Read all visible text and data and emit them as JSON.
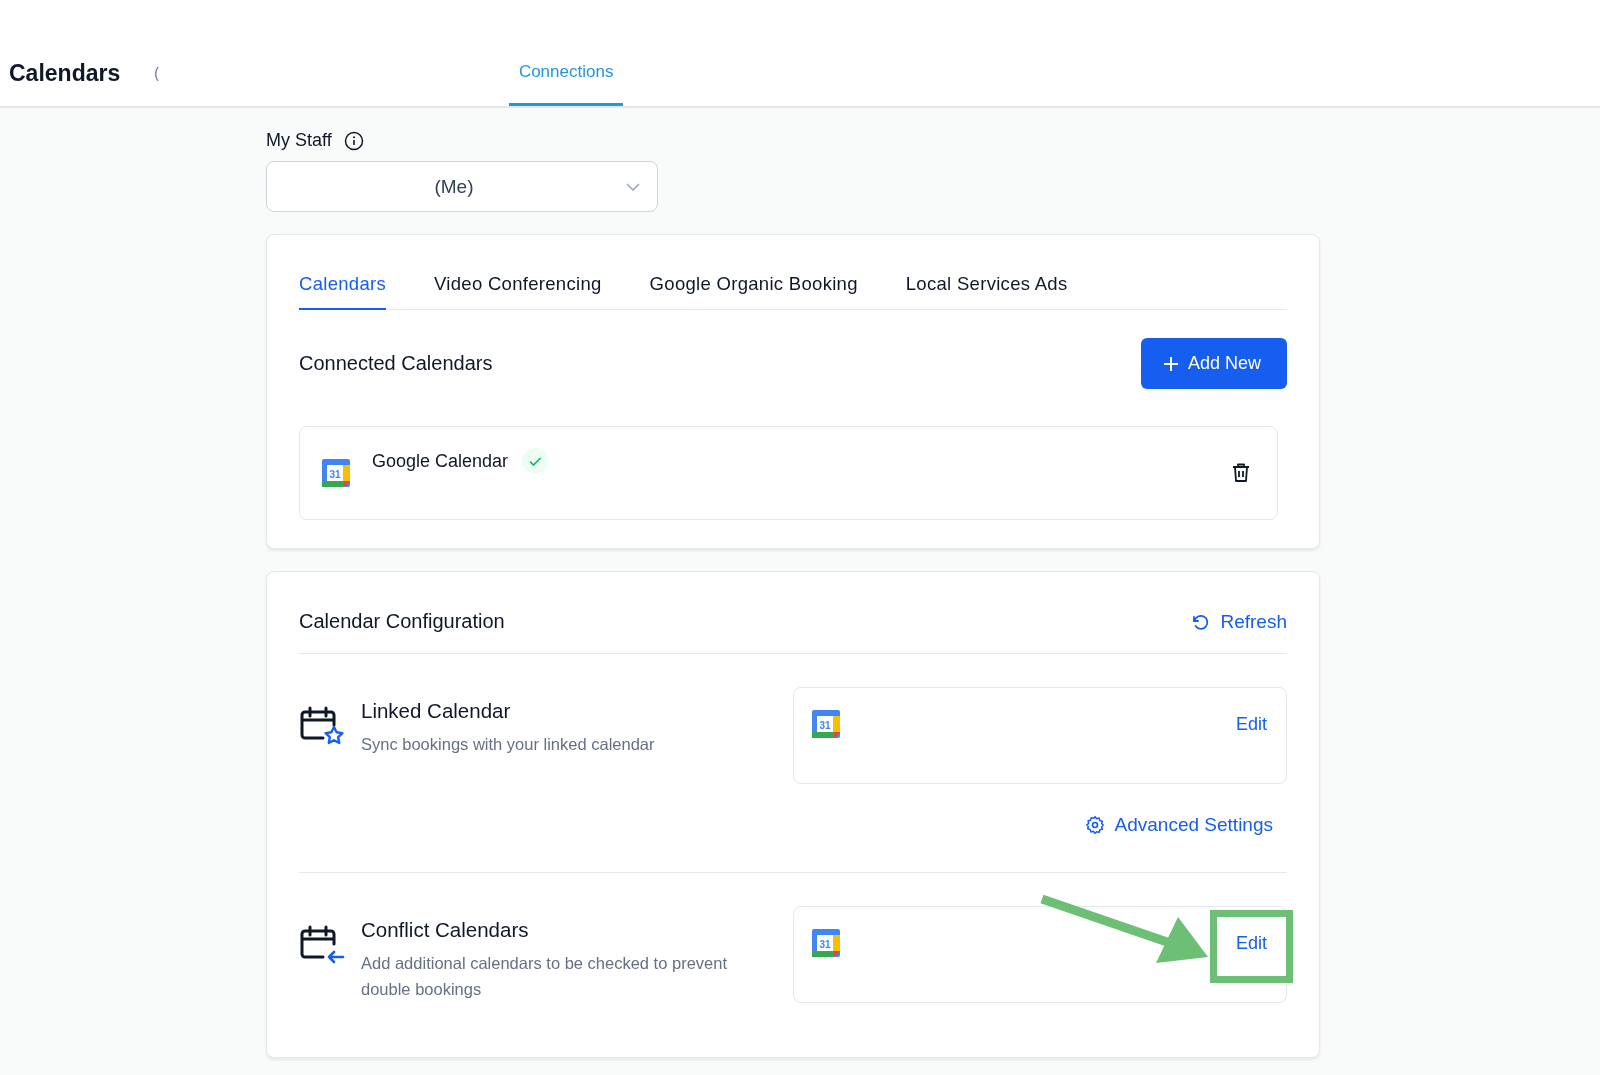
{
  "header": {
    "title": "Calendars",
    "cut_text": "(",
    "tabs": [
      {
        "label": "Connections",
        "selected": true
      }
    ]
  },
  "staff": {
    "label": "My Staff",
    "value": "(Me)"
  },
  "connections_card": {
    "tabs": [
      {
        "label": "Calendars",
        "selected": true
      },
      {
        "label": "Video Conferencing",
        "selected": false
      },
      {
        "label": "Google Organic Booking",
        "selected": false
      },
      {
        "label": "Local Services Ads",
        "selected": false
      }
    ],
    "heading": "Connected Calendars",
    "add_button": "Add New",
    "calendars": [
      {
        "name": "Google Calendar",
        "icon_text": "31",
        "connected": true
      }
    ]
  },
  "configuration": {
    "heading": "Calendar Configuration",
    "refresh": "Refresh",
    "rows": [
      {
        "kind": "linked",
        "title": "Linked Calendar",
        "description": "Sync bookings with your linked calendar",
        "icon_text": "31",
        "action": "Edit",
        "extra_link": "Advanced Settings"
      },
      {
        "kind": "conflict",
        "title": "Conflict Calendars",
        "description": "Add additional calendars to be checked to prevent double bookings",
        "icon_text": "31",
        "action": "Edit",
        "highlighted": true
      }
    ]
  }
}
